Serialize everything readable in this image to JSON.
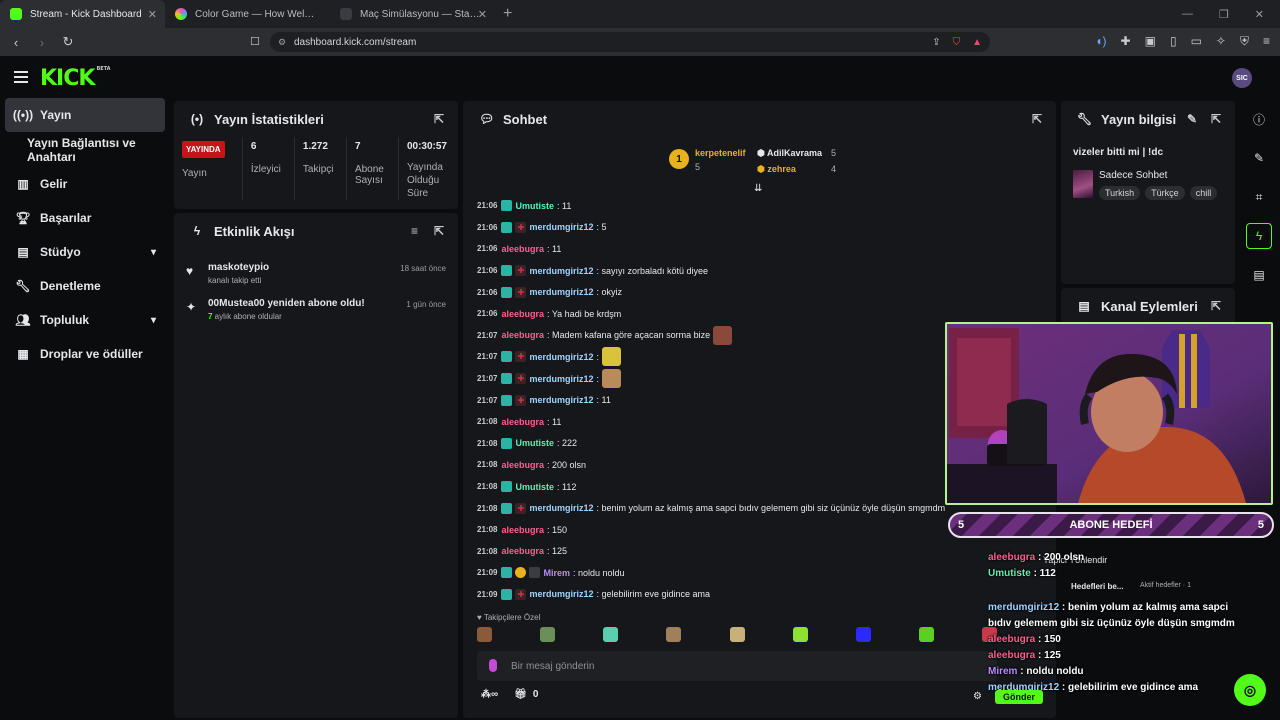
{
  "browser": {
    "tabs": [
      {
        "title": "Stream - Kick Dashboard",
        "color": "#53fc18"
      },
      {
        "title": "Color Game — How Well Can You Re",
        "color": "#ea4cc0"
      },
      {
        "title": "Maç Simülasyonu — StatsLook | Stats",
        "color": "#20232a"
      }
    ],
    "url": "dashboard.kick.com/stream"
  },
  "header": {
    "logo": "KICK",
    "logo_beta": "BETA",
    "avatar_text": "SIC"
  },
  "sidebar": {
    "items": [
      {
        "label": "Yayın"
      },
      {
        "label": "Yayın Bağlantısı ve Anahtarı"
      },
      {
        "label": "Gelir"
      },
      {
        "label": "Başarılar"
      },
      {
        "label": "Stüdyo"
      },
      {
        "label": "Denetleme"
      },
      {
        "label": "Topluluk"
      },
      {
        "label": "Droplar ve ödüller"
      }
    ]
  },
  "stats": {
    "title": "Yayın İstatistikleri",
    "live_badge": "YAYINDA",
    "live_label": "Yayın",
    "items": [
      {
        "value": "6",
        "label": "İzleyici"
      },
      {
        "value": "1.272",
        "label": "Takipçi"
      },
      {
        "value": "7",
        "label": "Abone Sayısı"
      },
      {
        "value": "00:30:57",
        "label": "Yayında Olduğu Süre"
      }
    ]
  },
  "activity": {
    "title": "Etkinlik Akışı",
    "items": [
      {
        "title": "maskoteypio",
        "sub": "kanalı takip etti",
        "time": "18 saat önce"
      },
      {
        "title": "00Mustea00 yeniden abone oldu!",
        "sub_bold": "7",
        "sub": " aylık abone oldular",
        "time": "1 gün önce"
      }
    ]
  },
  "chat": {
    "title": "Sohbet",
    "pinned": [
      {
        "name": "kerpetenelif",
        "count": "5"
      },
      {
        "name": "AdilKavrama",
        "count": "5"
      },
      {
        "name": "zehrea",
        "count": "4"
      }
    ],
    "messages": [
      {
        "time": "21:06",
        "user": "Umutiste",
        "color": "#5af0b3",
        "badges": [
          "b1"
        ],
        "text": ": 11"
      },
      {
        "time": "21:06",
        "user": "merdumgiriz12",
        "color": "#9fd4ff",
        "badges": [
          "b1",
          "b2"
        ],
        "text": ": 5"
      },
      {
        "time": "21:06",
        "user": "aleebugra",
        "color": "#ff5d8f",
        "badges": [],
        "text": ": 11"
      },
      {
        "time": "21:06",
        "user": "merdumgiriz12",
        "color": "#9fd4ff",
        "badges": [
          "b1",
          "b2"
        ],
        "text": ": sayıyı zorbaladı kötü diyee"
      },
      {
        "time": "21:06",
        "user": "merdumgiriz12",
        "color": "#9fd4ff",
        "badges": [
          "b1",
          "b2"
        ],
        "text": ": okyiz"
      },
      {
        "time": "21:06",
        "user": "aleebugra",
        "color": "#ff5d8f",
        "badges": [],
        "text": ": Ya hadi be krdşm"
      },
      {
        "time": "21:07",
        "user": "aleebugra",
        "color": "#ff5d8f",
        "badges": [],
        "text": ": Madem kafana göre açacan sorma bize",
        "emote": "#8a4a3a"
      },
      {
        "time": "21:07",
        "user": "merdumgiriz12",
        "color": "#9fd4ff",
        "badges": [
          "b1",
          "b2"
        ],
        "text": ": ",
        "emote": "#d8c43a"
      },
      {
        "time": "21:07",
        "user": "merdumgiriz12",
        "color": "#9fd4ff",
        "badges": [
          "b1",
          "b2"
        ],
        "text": ": ",
        "emote": "#b98a5a"
      },
      {
        "time": "21:07",
        "user": "merdumgiriz12",
        "color": "#9fd4ff",
        "badges": [
          "b1",
          "b2"
        ],
        "text": ": 11"
      },
      {
        "time": "21:08",
        "user": "aleebugra",
        "color": "#ff5d8f",
        "badges": [],
        "text": ": 11"
      },
      {
        "time": "21:08",
        "user": "Umutiste",
        "color": "#5af0b3",
        "badges": [
          "b1"
        ],
        "text": ": 222"
      },
      {
        "time": "21:08",
        "user": "aleebugra",
        "color": "#ff5d8f",
        "badges": [],
        "text": ": 200 olsn"
      },
      {
        "time": "21:08",
        "user": "Umutiste",
        "color": "#5af0b3",
        "badges": [
          "b1"
        ],
        "text": ": 112"
      },
      {
        "time": "21:08",
        "user": "merdumgiriz12",
        "color": "#9fd4ff",
        "badges": [
          "b1",
          "b2"
        ],
        "text": ": benim yolum az kalmış ama sapci bıdıv gelemem gibi siz üçünüz öyle düşün smgmdm"
      },
      {
        "time": "21:08",
        "user": "aleebugra",
        "color": "#ff5d8f",
        "badges": [],
        "text": ": 150"
      },
      {
        "time": "21:08",
        "user": "aleebugra",
        "color": "#ff5d8f",
        "badges": [],
        "text": ": 125"
      },
      {
        "time": "21:09",
        "user": "Mirem",
        "color": "#b88cff",
        "badges": [
          "b1",
          "b3",
          "b4"
        ],
        "text": ": noldu noldu"
      },
      {
        "time": "21:09",
        "user": "merdumgiriz12",
        "color": "#9fd4ff",
        "badges": [
          "b1",
          "b2"
        ],
        "text": ": gelebilirim eve gidince ama"
      }
    ],
    "followers_label": "♥ Takipçilere Özel",
    "emote_colors": [
      "#8a5a3a",
      "#6b8f5a",
      "#5acfb0",
      "#a0805a",
      "#c8b07a",
      "#8fe030",
      "#2a2aff",
      "#5ad020",
      "#c83a4a"
    ],
    "input_placeholder": "Bir mesaj gönderin",
    "points": "0",
    "send_label": "Gönder"
  },
  "stream_info": {
    "title": "Yayın bilgisi",
    "stream_title": "vizeler bitti mi | !dc",
    "category": "Sadece Sohbet",
    "tags": [
      "Turkish",
      "Türkçe",
      "chill"
    ]
  },
  "channel_actions": {
    "title": "Kanal Eylemleri"
  },
  "overlay": {
    "goal_label": "ABONE HEDEFİ",
    "goal_left": "5",
    "goal_right": "5",
    "partial_text_1": "Hedefleri be...",
    "partial_text_2": "Aktif hedefler · 1",
    "partial_text_3": "Yapici Yönlendir",
    "lines": [
      {
        "user": "aleebugra",
        "cls": "u1",
        "text": " : 200 olsn"
      },
      {
        "user": "Umutiste",
        "cls": "u2",
        "text": " : 112"
      },
      {
        "user": "merdumgiriz12",
        "cls": "u3",
        "text": " : benim yolum az kalmış ama sapci bıdıv gelemem gibi siz üçünüz öyle düşün smgmdm"
      },
      {
        "user": "aleebugra",
        "cls": "u1",
        "text": " : 150"
      },
      {
        "user": "aleebugra",
        "cls": "u1",
        "text": " : 125"
      },
      {
        "user": "Mirem",
        "cls": "u4",
        "text": " : noldu noldu"
      },
      {
        "user": "merdumgiriz12",
        "cls": "u3",
        "text": " : gelebilirim eve gidince ama"
      }
    ]
  },
  "colors": {
    "brand": "#53fc18",
    "live": "#c9131a",
    "panel": "#16171a"
  }
}
